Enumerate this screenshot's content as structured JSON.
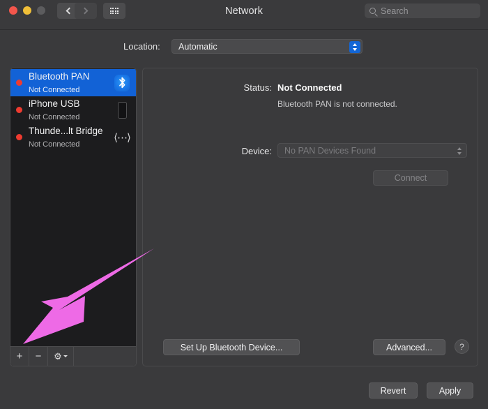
{
  "window": {
    "title": "Network",
    "traffic_lights": [
      "close",
      "minimize",
      "zoom"
    ],
    "nav": {
      "back": "back-chevron",
      "forward": "forward-chevron",
      "show_all": "grid-icon"
    },
    "search": {
      "placeholder": "Search",
      "value": "",
      "icon": "search-icon"
    }
  },
  "location": {
    "label": "Location:",
    "selected": "Automatic",
    "options": [
      "Automatic"
    ]
  },
  "sidebar": {
    "services": [
      {
        "name": "Bluetooth PAN",
        "status": "Not Connected",
        "status_color": "#ee3b30",
        "icon": "bluetooth-icon",
        "selected": true
      },
      {
        "name": "iPhone USB",
        "status": "Not Connected",
        "status_color": "#ee3b30",
        "icon": "iphone-icon",
        "selected": false
      },
      {
        "name": "Thunde...lt Bridge",
        "status": "Not Connected",
        "status_color": "#ee3b30",
        "icon": "thunderbolt-bridge-icon",
        "selected": false
      }
    ],
    "footer": {
      "add": "+",
      "remove": "−",
      "actions": "⚙",
      "actions_icon": "gear-icon"
    }
  },
  "main": {
    "status_label": "Status:",
    "status_value": "Not Connected",
    "status_note": "Bluetooth PAN is not connected.",
    "device_label": "Device:",
    "device_value": "No PAN Devices Found",
    "device_disabled": true,
    "connect_label": "Connect",
    "connect_disabled": true,
    "setup_label": "Set Up Bluetooth Device...",
    "advanced_label": "Advanced...",
    "help_label": "?"
  },
  "footer": {
    "revert_label": "Revert",
    "apply_label": "Apply"
  },
  "annotation": {
    "arrow_color": "#ee6ae6",
    "points_to": "add-service-button"
  },
  "colors": {
    "window_background": "#3a3a3c",
    "sidebar_background": "#1c1c1e",
    "selection_blue": "#1262d6",
    "accent_blue": "#1366d6",
    "status_red": "#ee3b30",
    "arrow_pink": "#ee6ae6"
  }
}
